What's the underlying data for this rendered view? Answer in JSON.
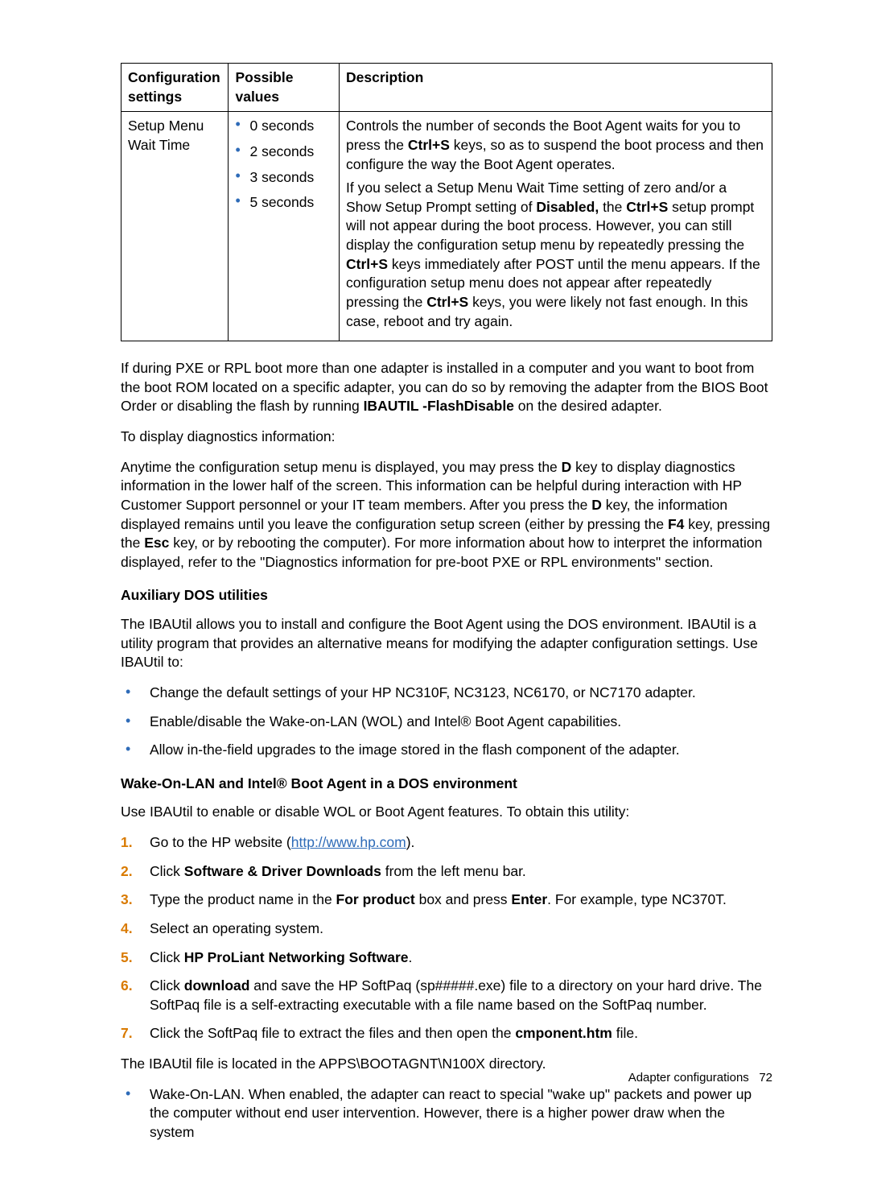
{
  "table": {
    "headers": [
      "Configuration settings",
      "Possible values",
      "Description"
    ],
    "row": {
      "setting": "Setup Menu Wait Time",
      "values": [
        "0 seconds",
        "2 seconds",
        "3 seconds",
        "5 seconds"
      ],
      "desc1_a": "Controls the number of seconds the Boot Agent waits for you to press the ",
      "desc1_b": "Ctrl+S",
      "desc1_c": " keys, so as to suspend the boot process and then configure the way the Boot Agent operates.",
      "desc2_a": "If you select a Setup Menu Wait Time setting of zero and/or a Show Setup Prompt setting of ",
      "desc2_b": "Disabled,",
      "desc2_c": " the ",
      "desc2_d": "Ctrl+S",
      "desc2_e": " setup prompt will not appear during the boot process. However, you can still display the configuration setup menu by repeatedly pressing the ",
      "desc2_f": "Ctrl+S",
      "desc2_g": " keys immediately after POST until the menu appears. If the configuration setup menu does not appear after repeatedly pressing the ",
      "desc2_h": "Ctrl+S",
      "desc2_i": " keys, you were likely not fast enough. In this case, reboot and try again."
    }
  },
  "para1_a": "If during PXE or RPL boot more than one adapter is installed in a computer and you want to boot from the boot ROM located on a specific adapter, you can do so by removing the adapter from the BIOS Boot Order or disabling the flash by running ",
  "para1_b": "IBAUTIL -FlashDisable",
  "para1_c": " on the desired adapter.",
  "para2": "To display diagnostics information:",
  "para3_a": "Anytime the configuration setup menu is displayed, you may press the ",
  "para3_b": "D",
  "para3_c": " key to display diagnostics information in the lower half of the screen. This information can be helpful during interaction with HP Customer Support personnel or your IT team members. After you press the ",
  "para3_d": "D",
  "para3_e": " key, the information displayed remains until you leave the configuration setup screen (either by pressing the ",
  "para3_f": "F4",
  "para3_g": " key, pressing the ",
  "para3_h": "Esc",
  "para3_i": " key, or by rebooting the computer). For more information about how to interpret the information displayed, refer to the \"Diagnostics information for pre-boot PXE or RPL environments\" section.",
  "h3_aux": "Auxiliary DOS utilities",
  "para4": "The IBAUtil allows you to install and configure the Boot Agent using the DOS environment. IBAUtil is a utility program that provides an alternative means for modifying the adapter configuration settings. Use IBAUtil to:",
  "bullets1": {
    "b1": "Change the default settings of your HP NC310F, NC3123, NC6170, or NC7170 adapter.",
    "b2": "Enable/disable the Wake-on-LAN (WOL) and Intel® Boot Agent capabilities.",
    "b3": "Allow in-the-field upgrades to the image stored in the flash component of the adapter."
  },
  "h3_wol": "Wake-On-LAN and Intel® Boot Agent in a DOS environment",
  "para5": "Use IBAUtil to enable or disable WOL or Boot Agent features. To obtain this utility:",
  "steps": {
    "s1_a": "Go to the HP website (",
    "s1_link": "http://www.hp.com",
    "s1_b": ").",
    "s2_a": "Click ",
    "s2_b": "Software & Driver Downloads",
    "s2_c": " from the left menu bar.",
    "s3_a": "Type the product name in the ",
    "s3_b": "For product",
    "s3_c": " box and press ",
    "s3_d": "Enter",
    "s3_e": ". For example, type NC370T.",
    "s4": "Select an operating system.",
    "s5_a": "Click ",
    "s5_b": "HP ProLiant Networking Software",
    "s5_c": ".",
    "s6_a": "Click ",
    "s6_b": "download",
    "s6_c": " and save the HP SoftPaq (sp#####.exe) file to a directory on your hard drive. The SoftPaq file is a self-extracting executable with a file name based on the SoftPaq number.",
    "s7_a": "Click the SoftPaq file to extract the files and then open the ",
    "s7_b": "cmponent.htm",
    "s7_c": " file."
  },
  "para6": "The IBAUtil file is located in the APPS\\BOOTAGNT\\N100X directory.",
  "bullets2": {
    "b1": "Wake-On-LAN. When enabled, the adapter can react to special \"wake up\" packets and power up the computer without end user intervention. However, there is a higher power draw when the system"
  },
  "footer": {
    "label": "Adapter configurations",
    "page": "72"
  }
}
